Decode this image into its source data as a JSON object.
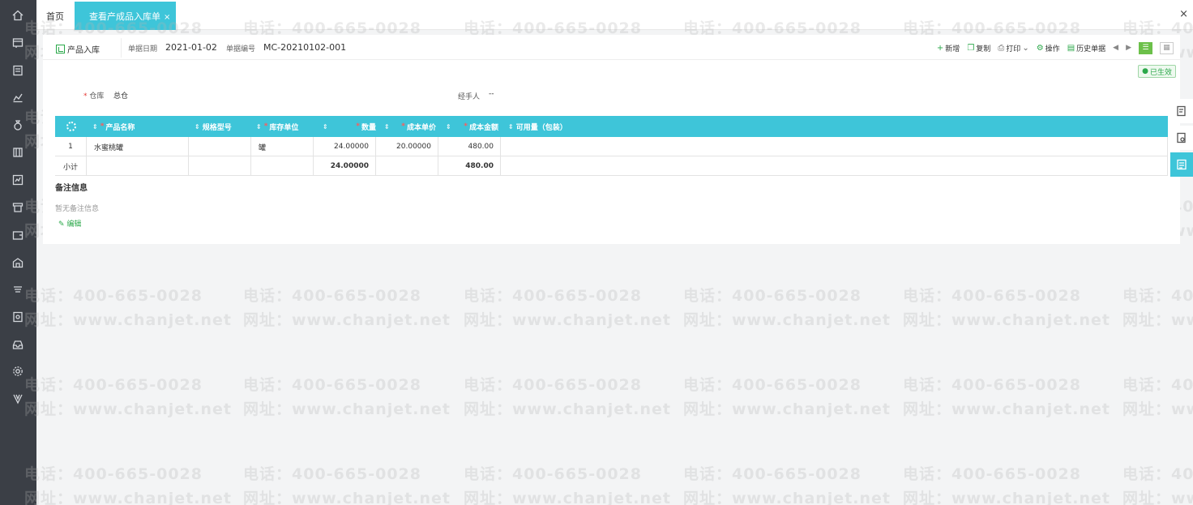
{
  "tabs": {
    "home": "首页",
    "active": "查看产成品入库单",
    "close_glyph": "×"
  },
  "window": {
    "close_glyph": "×"
  },
  "doc": {
    "title": "产品入库",
    "date_label": "单据日期",
    "date_value": "2021-01-02",
    "code_label": "单据编号",
    "code_value": "MC-20210102-001"
  },
  "actions": {
    "new": "新增",
    "copy": "复制",
    "print": "打印",
    "operate": "操作",
    "history": "历史单据"
  },
  "status": {
    "label": "已生效",
    "color": "#2ba84a"
  },
  "fields": {
    "warehouse_label": "仓库",
    "warehouse_value": "总仓",
    "handler_label": "经手人",
    "handler_value": "--"
  },
  "table": {
    "headers": [
      "产品名称",
      "规格型号",
      "库存单位",
      "数量",
      "成本单价",
      "成本金额",
      "可用量（包装）"
    ],
    "rows": [
      {
        "idx": "1",
        "name": "水蜜桃罐",
        "spec": "",
        "unit": "罐",
        "qty": "24.00000",
        "price": "20.00000",
        "amount": "480.00",
        "avail": ""
      }
    ],
    "subtotal": {
      "label": "小计",
      "qty": "24.00000",
      "amount": "480.00"
    }
  },
  "notes": {
    "title": "备注信息",
    "empty": "暂无备注信息",
    "edit": "编辑"
  },
  "watermark": {
    "line1": "电话：400-665-0028",
    "line2": "网址：www.chanjet.net"
  },
  "colors": {
    "accent": "#3ec5d9",
    "sidebar": "#3b3f46",
    "green": "#2ba84a"
  }
}
